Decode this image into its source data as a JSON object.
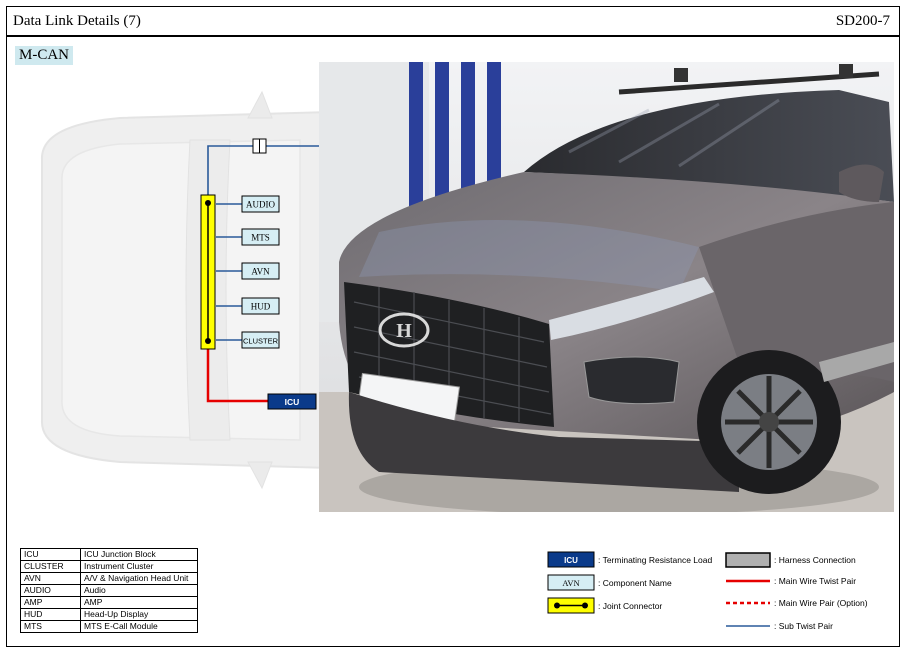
{
  "header": {
    "title": "Data Link Details (7)",
    "code": "SD200-7"
  },
  "section": "M-CAN",
  "diagram": {
    "joint_components": [
      "AUDIO",
      "MTS",
      "AVN",
      "HUD",
      "CLUSTER"
    ],
    "terminating_component": "ICU"
  },
  "abbreviations": [
    {
      "key": "ICU",
      "value": "ICU Junction Block"
    },
    {
      "key": "CLUSTER",
      "value": "Instrument Cluster"
    },
    {
      "key": "AVN",
      "value": "A/V & Navigation Head Unit"
    },
    {
      "key": "AUDIO",
      "value": "Audio"
    },
    {
      "key": "AMP",
      "value": "AMP"
    },
    {
      "key": "HUD",
      "value": "Head-Up Display"
    },
    {
      "key": "MTS",
      "value": "MTS E-Call Module"
    }
  ],
  "legend": {
    "terminating_sample": "ICU",
    "terminating_label": ": Terminating Resistance Load",
    "component_sample": "AVN",
    "component_label": ": Component Name",
    "joint_label": ": Joint Connector",
    "harness_label": ": Harness Connection",
    "main_pair_label": ": Main Wire Twist Pair",
    "main_pair_option_label": ": Main Wire Pair (Option)",
    "sub_pair_label": ": Sub Twist Pair"
  },
  "colors": {
    "main_wire": "#e60000",
    "sub_wire": "#2a5a9a",
    "joint_fill": "#ffff00",
    "terminating_fill": "#0a3a8a",
    "component_fill": "#d6eef4",
    "section_tag": "#cfe9ef"
  }
}
